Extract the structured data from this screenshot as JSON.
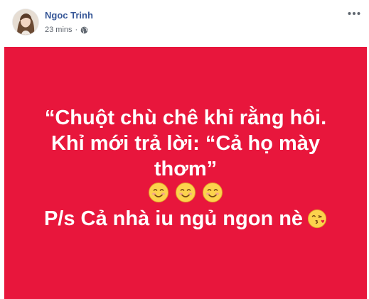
{
  "post": {
    "author": "Ngoc Trinh",
    "timestamp": "23 mins",
    "separator": "·",
    "privacy_icon": "globe-icon",
    "more_icon": "more-options-icon",
    "background_color": "#e8163c",
    "text_color": "#ffffff",
    "status_lines": [
      "“Chuột chù chê khỉ rằng hôi.",
      "Khỉ mới trả lời: “Cả họ mày",
      "thơm”"
    ],
    "emoji_row": [
      "smiling-face-icon",
      "smiling-face-icon",
      "smiling-face-icon"
    ],
    "last_line": "P/s Cả nhà iu ngủ ngon nè",
    "last_line_emoji": "face-blowing-kiss-icon"
  }
}
